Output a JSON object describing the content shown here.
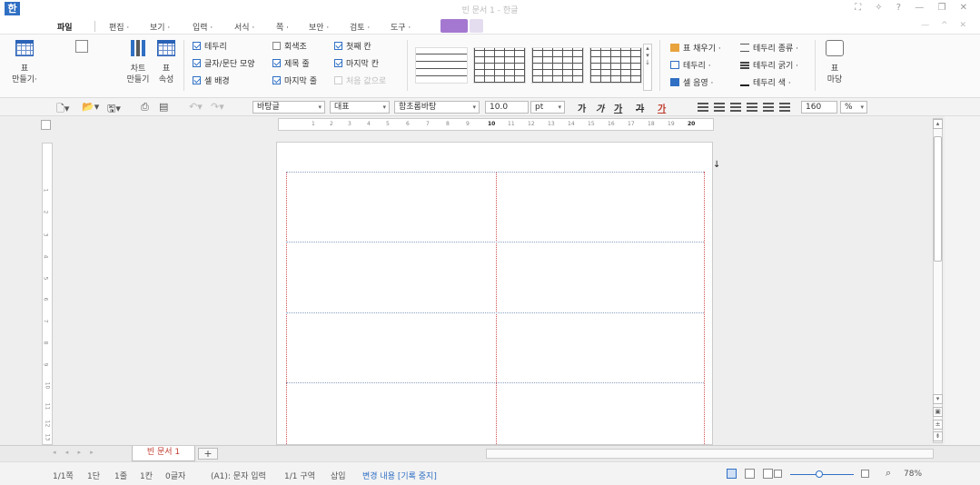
{
  "window": {
    "title": "빈 문서 1 - 한글",
    "logo": "한",
    "controls": "⛶ ✧ ? — ❐ ✕"
  },
  "menu": {
    "file": "파일",
    "items": [
      "편집 ·",
      "보기 ·",
      "입력 ·",
      "서식 ·",
      "쪽 ·",
      "보안 ·",
      "검토 ·",
      "도구 ·"
    ],
    "right": "— ^ ✕"
  },
  "ribbon": {
    "table_make": "표\n만들기·",
    "chart_make": "차트\n만들기",
    "table_props": "표\n속성",
    "checks": [
      {
        "label": "테두리",
        "state": "on"
      },
      {
        "label": "글자/문단 모양",
        "state": "on"
      },
      {
        "label": "셀 배경",
        "state": "on"
      },
      {
        "label": "회색조",
        "state": "off"
      },
      {
        "label": "제목 줄",
        "state": "on"
      },
      {
        "label": "마지막 줄",
        "state": "on"
      },
      {
        "label": "첫째 칸",
        "state": "on"
      },
      {
        "label": "마지막 칸",
        "state": "on"
      },
      {
        "label": "처음 값으로",
        "state": "disabled"
      }
    ],
    "right_items": [
      "표 채우기 ·",
      "테두리 ·",
      "셀 음영 ·",
      "테두리 종류 ·",
      "테두리 굵기 ·",
      "테두리 색 ·"
    ],
    "madang": "표\n마당"
  },
  "toolbar": {
    "style": "바탕글",
    "lang": "대표",
    "font": "함초롬바탕",
    "size": "10.0",
    "unit": "pt",
    "line_spacing": "160",
    "line_unit": "%",
    "fmt": [
      "가",
      "가",
      "가",
      "가",
      "가"
    ]
  },
  "ruler": {
    "ticks": [
      "1",
      "2",
      "3",
      "4",
      "5",
      "6",
      "7",
      "8",
      "9",
      "10",
      "11",
      "12",
      "13",
      "14",
      "15",
      "16",
      "17",
      "18",
      "19",
      "20"
    ]
  },
  "vruler": {
    "ticks": [
      "1",
      "2",
      "3",
      "4",
      "5",
      "6",
      "7",
      "8",
      "9",
      "10",
      "11",
      "12",
      "13"
    ]
  },
  "tabs": {
    "doc": "빈 문서 1",
    "add": "+"
  },
  "status": {
    "page": "1/1쪽",
    "col": "1단",
    "line": "1줄",
    "cell": "1칸",
    "chars": "0글자",
    "mode": "(A1): 문자 입력",
    "section": "1/1 구역",
    "insert": "삽입",
    "track": "변경 내용 [기록 중지]",
    "zoom": "78%"
  },
  "colors": {
    "accent": "#2f6fc4",
    "menu_active": "#a478d0",
    "tab_text": "#c0392b"
  }
}
